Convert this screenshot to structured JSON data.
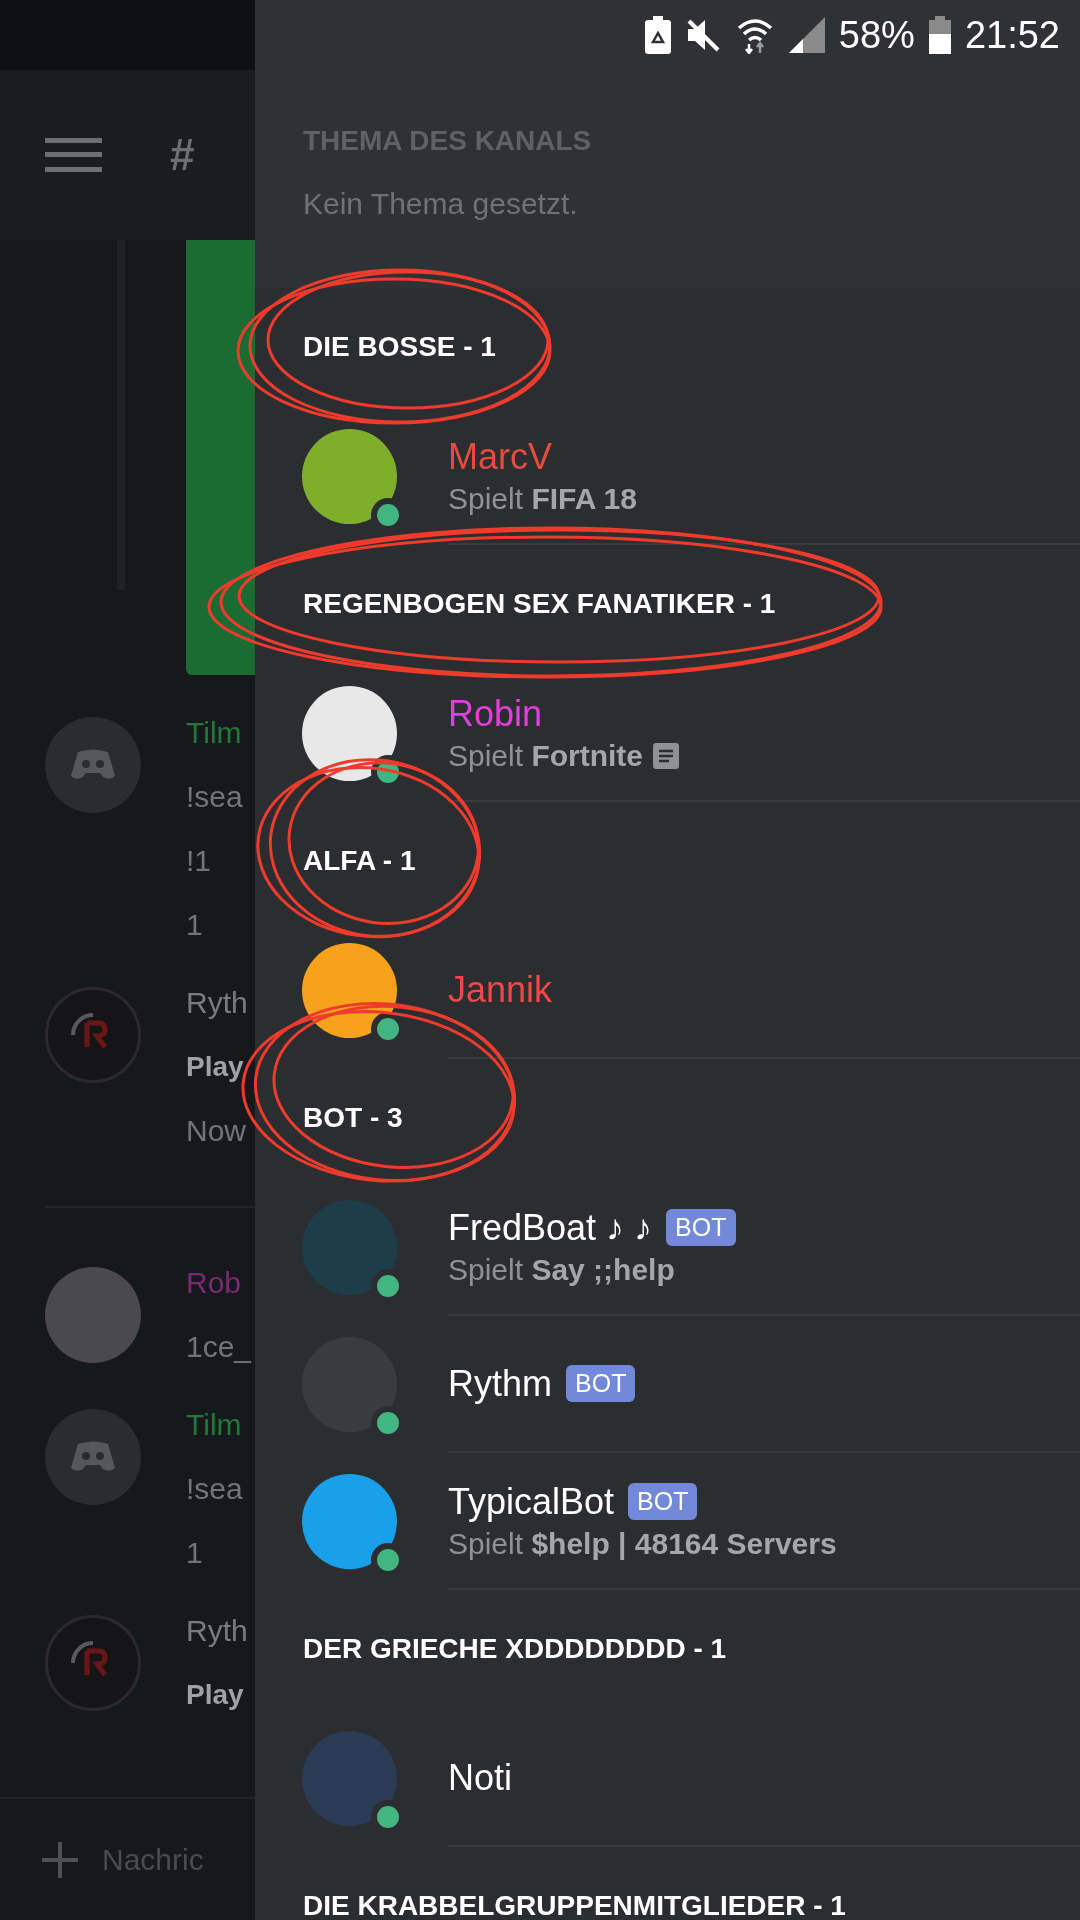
{
  "status_bar": {
    "battery_percent": "58%",
    "time": "21:52"
  },
  "chat": {
    "channel_title": "#",
    "messages": [
      {
        "kind": "message",
        "author": "Tilm",
        "color": "#1f7a3a",
        "lines": [
          {
            "text": "!sea",
            "bold": false
          },
          {
            "text": "!1",
            "bold": false
          },
          {
            "text": "1",
            "bold": false
          }
        ]
      },
      {
        "kind": "message",
        "author": "Ryth",
        "color": "#7a7b7e",
        "lines": [
          {
            "text": "Play",
            "bold": true
          },
          {
            "text": "Now",
            "bold": false
          }
        ]
      },
      {
        "kind": "divider"
      },
      {
        "kind": "message",
        "author": "Rob",
        "color": "#7a2a75",
        "lines": [
          {
            "text": "1ce_",
            "bold": false
          }
        ]
      },
      {
        "kind": "message",
        "author": "Tilm",
        "color": "#1f7a3a",
        "lines": [
          {
            "text": "!sea",
            "bold": false
          },
          {
            "text": "1",
            "bold": false
          }
        ]
      },
      {
        "kind": "message",
        "author": "Ryth",
        "color": "#7a7b7e",
        "lines": [
          {
            "text": "Play",
            "bold": true
          }
        ]
      }
    ],
    "input": {
      "placeholder": "Nachric"
    }
  },
  "topic": {
    "title": "THEMA DES KANALS",
    "text": "Kein Thema gesetzt."
  },
  "sections": [
    {
      "title": "DIE BOSSE - 1",
      "members": [
        {
          "name": "MarcV",
          "color": "#e74c3c",
          "activity": "Spielt **FIFA 18**",
          "activity_icon": false
        }
      ]
    },
    {
      "title": "REGENBOGEN SEX FANATIKER - 1",
      "members": [
        {
          "name": "Robin",
          "color": "#e040d8",
          "activity": "Spielt **Fortnite**",
          "activity_icon": true
        }
      ]
    },
    {
      "title": "ALFA - 1",
      "members": [
        {
          "name": "Jannik",
          "color": "#f04747"
        }
      ]
    },
    {
      "title": "BOT - 3",
      "members": [
        {
          "name": "FredBoat ♪ ♪",
          "color": "#ffffff",
          "tag": "BOT",
          "activity": "Spielt **Say ;;help**",
          "activity_icon": false
        },
        {
          "name": "Rythm",
          "color": "#ffffff",
          "tag": "BOT"
        },
        {
          "name": "TypicalBot",
          "color": "#ffffff",
          "tag": "BOT",
          "activity": "Spielt **$help | 48164 Servers**",
          "activity_icon": false
        }
      ]
    },
    {
      "title": "DER GRIECHE XDDDDDDDD - 1",
      "members": [
        {
          "name": "Noti",
          "color": "#ffffff"
        }
      ]
    },
    {
      "title": "DIE KRABBELGRUPPENMITGLIEDER - 1"
    }
  ]
}
